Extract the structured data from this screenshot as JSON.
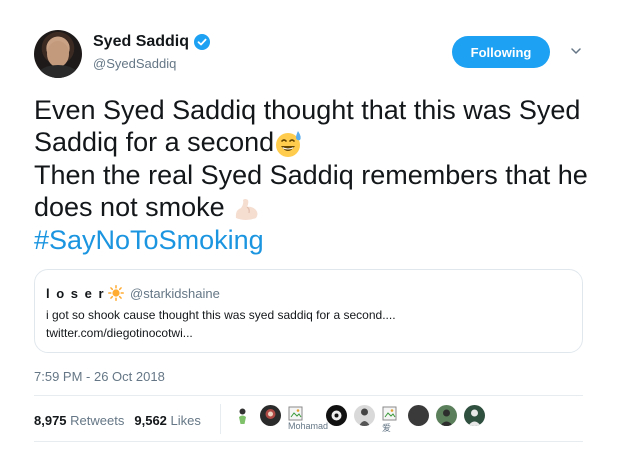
{
  "author": {
    "name": "Syed Saddiq",
    "handle": "@SyedSaddiq",
    "verified": true
  },
  "follow_button": {
    "label": "Following",
    "color": "#1da1f2"
  },
  "menu": {
    "icon": "chevron-down-icon"
  },
  "tweet": {
    "line1": "Even Syed Saddiq thought that this was Syed",
    "line2": "Saddiq for a second",
    "line3": "Then the real Syed Saddiq remembers that he",
    "line4": "does not smoke",
    "hashtag": "#SayNoToSmoking",
    "emoji1": "sweat-smile-emoji",
    "emoji2": "flexed-biceps-emoji",
    "hashtag_color": "#1b95e0"
  },
  "quote": {
    "name": "l o s e r",
    "emoji": "sun-emoji",
    "handle": "@starkidshaine",
    "line1": "i got so shook cause thought this was syed saddiq for a second....",
    "line2": "twitter.com/diegotinocotwi..."
  },
  "timestamp": "7:59 PM - 26 Oct 2018",
  "stats": {
    "retweets_count": "8,975",
    "retweets_label": "Retweets",
    "likes_count": "9,562",
    "likes_label": "Likes"
  },
  "likers": [
    {
      "kind": "avatar",
      "icon": "user-avatar-1"
    },
    {
      "kind": "avatar",
      "icon": "user-avatar-2"
    },
    {
      "kind": "broken",
      "label": "Mohamad"
    },
    {
      "kind": "avatar",
      "icon": "user-avatar-3"
    },
    {
      "kind": "avatar",
      "icon": "user-avatar-4"
    },
    {
      "kind": "broken",
      "label": "爱"
    },
    {
      "kind": "avatar",
      "icon": "user-avatar-5"
    },
    {
      "kind": "avatar",
      "icon": "user-avatar-6"
    },
    {
      "kind": "avatar",
      "icon": "user-avatar-7"
    }
  ]
}
